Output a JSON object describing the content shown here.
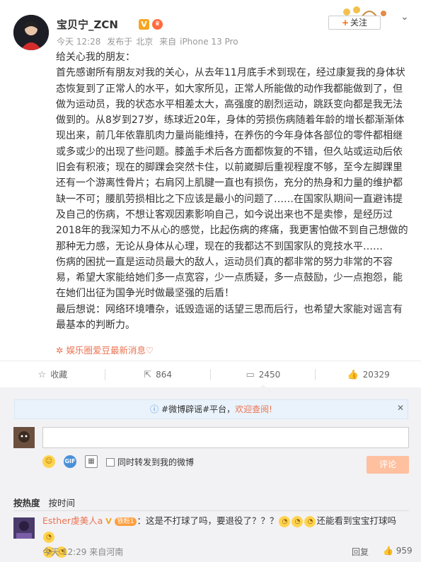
{
  "post": {
    "author": "宝贝宁_ZCN",
    "time": "今天 12:28",
    "posted_in_label": "发布于",
    "location": "北京",
    "source_label": "来自",
    "device": "iPhone 13 Pro",
    "follow_label": "关注",
    "content": [
      "给关心我的朋友：",
      "首先感谢所有朋友对我的关心，从去年11月底手术到现在，经过康复我的身体状态恢复到了正常人的水平，如大家所见，正常人所能做的动作我都能做到了，但做为运动员，我的状态水平相差太大，高强度的剧烈运动，跳跃变向都是我无法做到的。从8岁到27岁，练球近20年，身体的劳损伤病随着年龄的增长都渐渐体现出来，前几年依靠肌肉力量尚能维持，在养伤的今年身体各部位的零件都相继或多或少的出现了些问题。膝盖手术后各方面都恢复的不错，但久站或运动后依旧会有积液；现在的脚踝会突然卡住，以前崴脚后重视程度不够，至今左脚踝里还有一个游离性骨片；右肩冈上肌腱一直也有损伤，充分的热身和力量的维护都缺一不可；腰肌劳损相比之下应该是最小的问题了……在国家队期间一直避讳提及自己的伤病，不想让客观因素影响自己，如今说出来也不是卖惨，是经历过2018年的我深知力不从心的感觉，比起伤病的疼痛，我更害怕做不到自己想做的那种无力感，无论从身体从心理，现在的我都达不到国家队的竞技水平……",
      "伤病的困扰一直是运动员最大的敌人，运动员们真的都非常的努力非常的不容易，希望大家能给她们多一点宽容，少一点质疑，多一点鼓励，少一点抱怨，能在她们出征为国争光时做最坚强的后盾！",
      "最后想说：网络环境嘈杂，诋毁造谣的话望三思而后行，也希望大家能对谣言有最基本的判断力。"
    ],
    "topic": "娱乐圈爱豆最新消息♡"
  },
  "actions": {
    "favorite": "收藏",
    "repost": "864",
    "comment": "2450",
    "like": "20329"
  },
  "comments_panel": {
    "notice_prefix": "#微博辟谣#平台，",
    "notice_link": "欢迎查阅!",
    "repost_also_label": "同时转发到我的微博",
    "submit_label": "评论",
    "sort_hot": "按热度",
    "sort_time": "按时间"
  },
  "comment": {
    "user": "Esther虔美人a",
    "fan_badge": "铁粉1",
    "text_1": "：这是不打球了吗，要退役了？？？",
    "text_2": "还能看到宝宝打球吗",
    "time": "今天 12:29",
    "source": "来自河南",
    "reply_label": "回复",
    "likes": "959"
  },
  "colors": {
    "accent": "#eb7350",
    "comment_bg": "#f2f2f5"
  },
  "icons": [
    "star-icon",
    "repost-icon",
    "comment-icon",
    "like-icon",
    "emoji-icon",
    "gif-icon",
    "image-icon",
    "info-icon",
    "close-icon",
    "chevron-down-icon",
    "vip-icon",
    "crown-icon"
  ]
}
